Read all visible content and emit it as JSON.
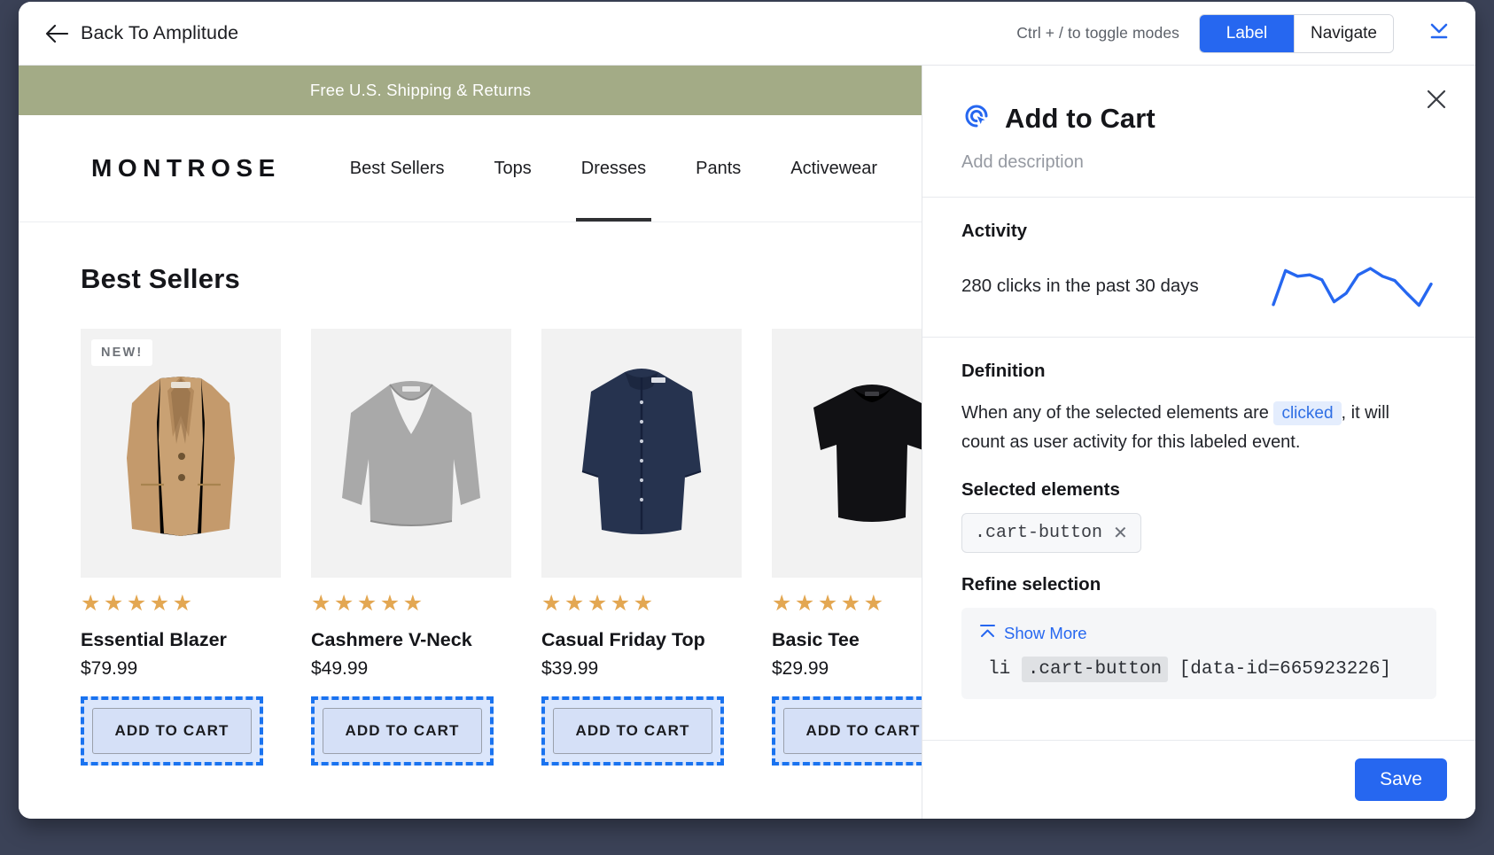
{
  "toolbar": {
    "back_label": "Back To Amplitude",
    "hint": "Ctrl + / to toggle modes",
    "modes": [
      {
        "label": "Label",
        "active": true
      },
      {
        "label": "Navigate",
        "active": false
      }
    ]
  },
  "store": {
    "shipping_banner": "Free U.S. Shipping & Returns",
    "brand": "MONTROSE",
    "nav": [
      {
        "label": "Best Sellers",
        "active": false
      },
      {
        "label": "Tops",
        "active": false
      },
      {
        "label": "Dresses",
        "active": true
      },
      {
        "label": "Pants",
        "active": false
      },
      {
        "label": "Activewear",
        "active": false
      }
    ],
    "section_title": "Best Sellers",
    "new_badge": "NEW!",
    "stars": "★★★★★",
    "add_to_cart_label": "ADD TO CART",
    "products": [
      {
        "name": "Essential Blazer",
        "price": "$79.99",
        "badge": "NEW!",
        "stars": "★★★★★",
        "garment": "blazer"
      },
      {
        "name": "Cashmere V-Neck",
        "price": "$49.99",
        "badge": "",
        "stars": "★★★★★",
        "garment": "sweater"
      },
      {
        "name": "Casual Friday Top",
        "price": "$39.99",
        "badge": "",
        "stars": "★★★★★",
        "garment": "shirt"
      },
      {
        "name": "Basic Tee",
        "price": "$29.99",
        "badge": "",
        "stars": "★★★★★",
        "garment": "tee"
      }
    ]
  },
  "panel": {
    "title": "Add to Cart",
    "description_placeholder": "Add description",
    "activity": {
      "heading": "Activity",
      "summary": "280 clicks in the past 30 days",
      "clicks": 280,
      "days": 30
    },
    "definition": {
      "heading": "Definition",
      "text_before": "When any of the selected elements are",
      "token": "clicked",
      "text_after": ", it will count as user activity for this labeled event."
    },
    "selected_elements": {
      "heading": "Selected elements",
      "chips": [
        {
          "label": ".cart-button"
        }
      ]
    },
    "refine": {
      "heading": "Refine selection",
      "show_more_label": "Show More",
      "selector_parts": {
        "tag": "li",
        "class": ".cart-button",
        "attr": "[data-id=665923226]"
      }
    },
    "save_label": "Save"
  },
  "colors": {
    "accent_blue": "#2667f0",
    "selection_blue": "#1a73f0",
    "banner_green": "#a3ab86",
    "star_gold": "#e3a752",
    "window_bg": "#3b4257"
  },
  "chart_data": {
    "type": "line",
    "title": "Activity sparkline",
    "xlabel": "",
    "ylabel": "clicks",
    "legend": "none",
    "grid": false,
    "x": [
      0,
      1,
      2,
      3,
      4,
      5,
      6,
      7,
      8,
      9,
      10,
      11,
      12,
      13
    ],
    "values": [
      4,
      52,
      44,
      46,
      39,
      8,
      20,
      46,
      55,
      44,
      38,
      20,
      3,
      33
    ],
    "ylim": [
      0,
      60
    ]
  }
}
